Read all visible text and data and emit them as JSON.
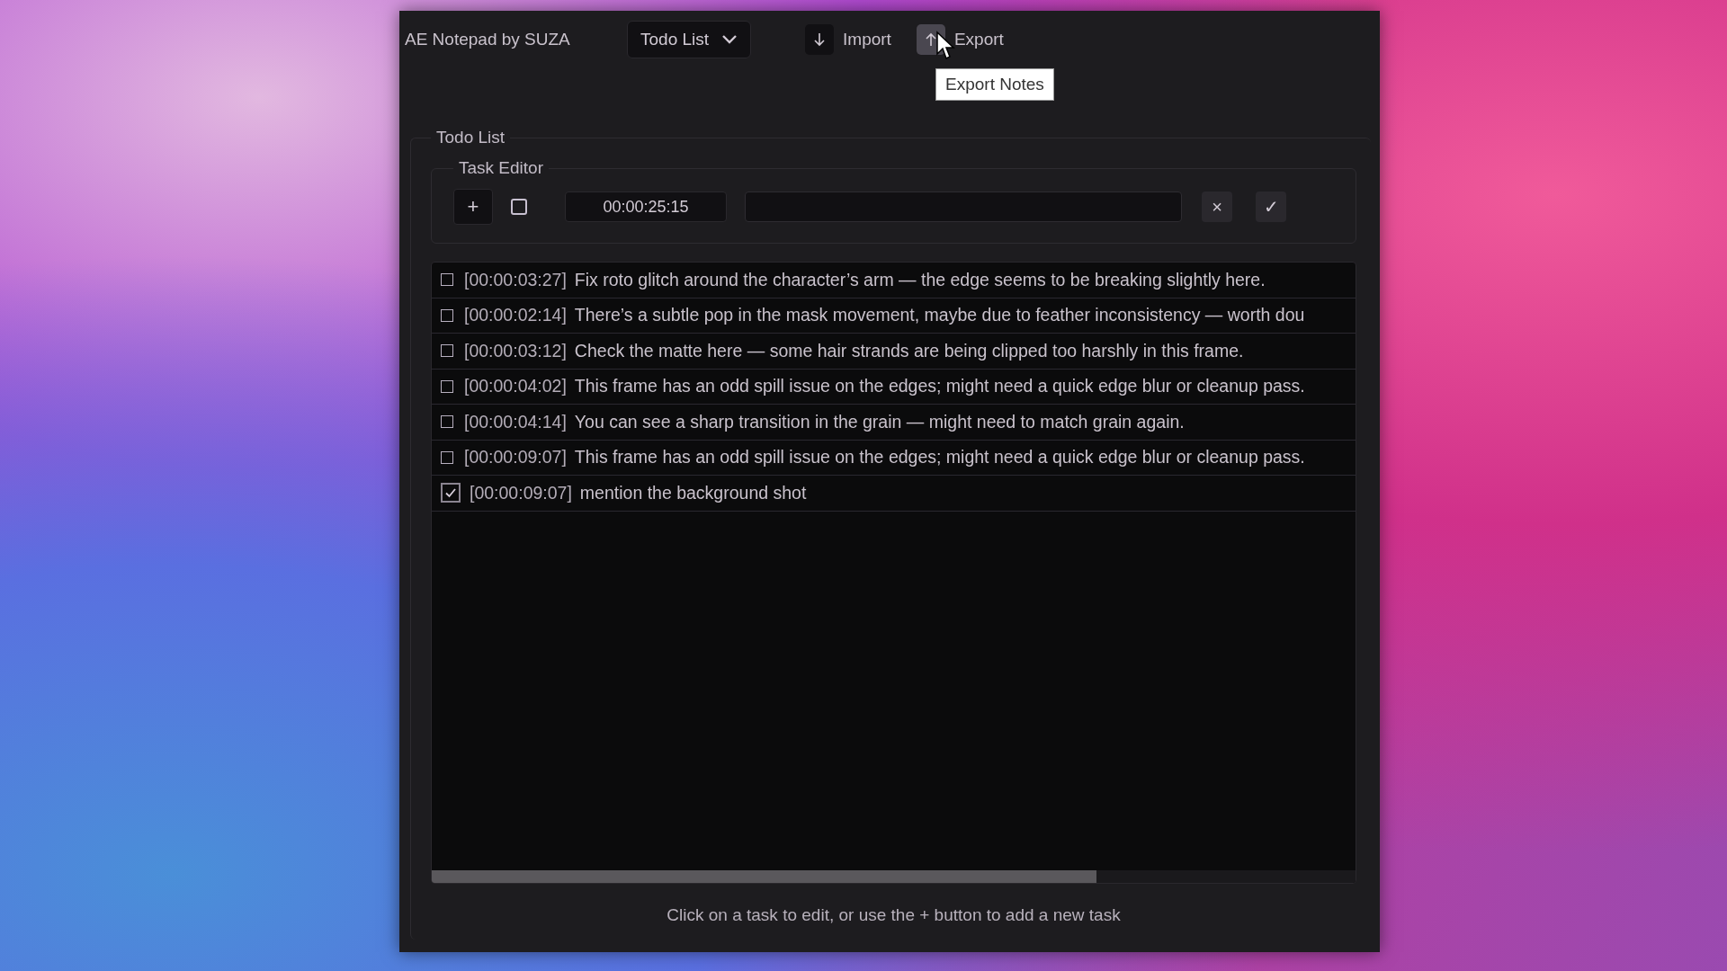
{
  "app": {
    "title": "AE Notepad by SUZA"
  },
  "toolbar": {
    "view_dropdown": {
      "value": "Todo List"
    },
    "import_button": {
      "label": "Import",
      "hovered": false
    },
    "export_button": {
      "label": "Export",
      "hovered": true
    }
  },
  "tooltip": {
    "text": "Export Notes"
  },
  "todo_group": {
    "title": "Todo List"
  },
  "task_editor": {
    "title": "Task Editor",
    "add_label": "+",
    "done_checked": false,
    "time_value": "00:00:25:15",
    "cancel_label": "×",
    "confirm_label": "✓"
  },
  "tasks": [
    {
      "time": "[00:00:03:27]",
      "text": "Fix roto glitch around the character’s arm — the edge seems to be breaking slightly here.",
      "checked": false
    },
    {
      "time": "[00:00:02:14]",
      "text": "There’s a subtle pop in the mask movement, maybe due to feather inconsistency — worth dou",
      "checked": false
    },
    {
      "time": "[00:00:03:12]",
      "text": "Check the matte here — some hair strands are being clipped too harshly in this frame.",
      "checked": false
    },
    {
      "time": "[00:00:04:02]",
      "text": "This frame has an odd spill issue on the edges; might need a quick edge blur or cleanup pass.",
      "checked": false
    },
    {
      "time": "[00:00:04:14]",
      "text": "You can see a sharp transition in the grain — might need to match grain again.",
      "checked": false
    },
    {
      "time": "[00:00:09:07]",
      "text": "This frame has an odd spill issue on the edges; might need a quick edge blur or cleanup pass.",
      "checked": false
    },
    {
      "time": "[00:00:09:07]",
      "text": "mention the background shot",
      "checked": true
    }
  ],
  "hint": "Click on a task to edit, or use the + button to add a new task"
}
